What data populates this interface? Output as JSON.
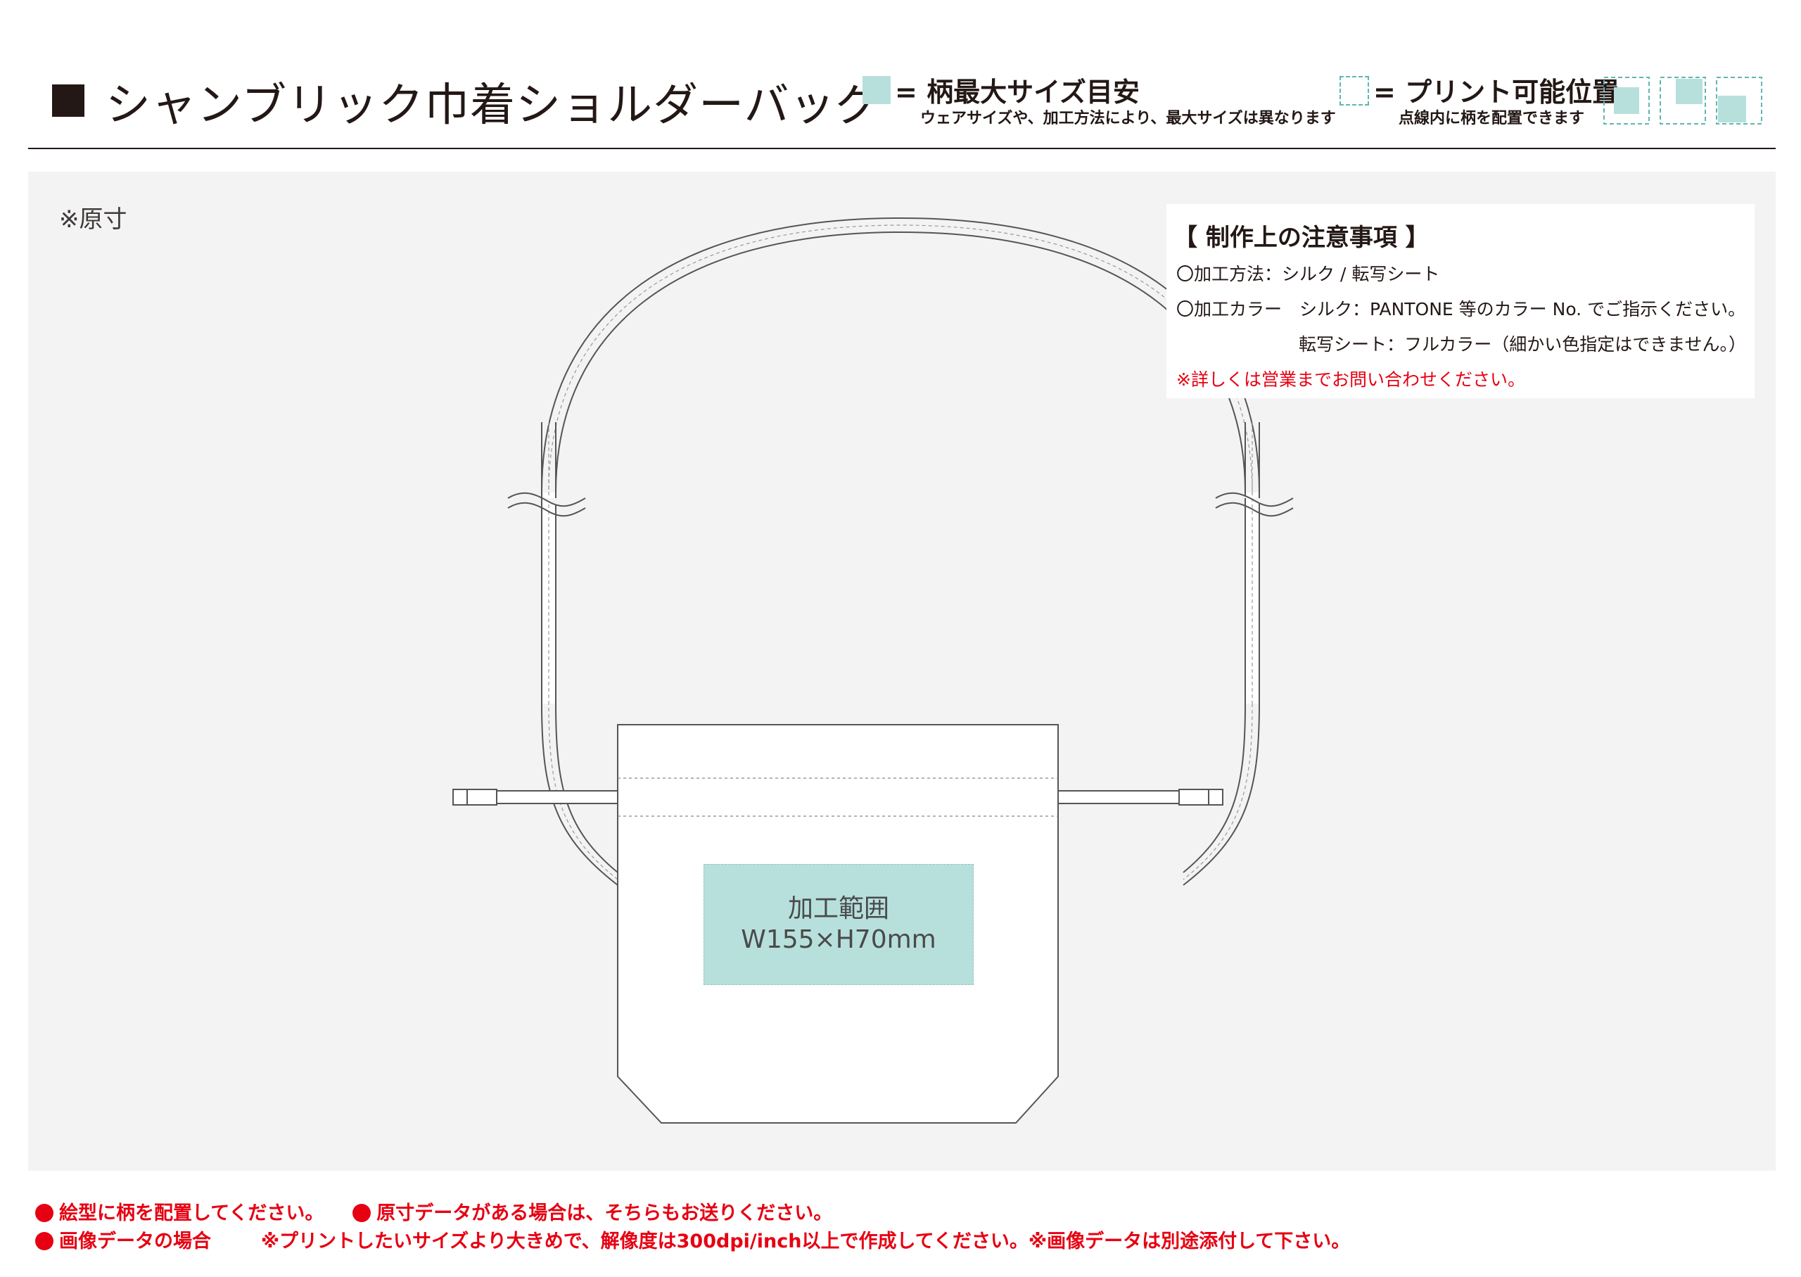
{
  "header": {
    "title": "シャンブリック巾着ショルダーバッグ",
    "legend_max_size_label": "= 柄最大サイズ目安",
    "legend_max_size_note": "ウェアサイズや、加工方法により、最大サイズは異なります",
    "legend_position_label": "= プリント可能位置",
    "legend_position_note": "点線内に柄を配置できます",
    "swatch_color": "#b7e0dd",
    "dash_color": "#5fb7b0"
  },
  "canvas": {
    "original_size_note": "※原寸"
  },
  "notes": {
    "title": "【 制作上の注意事項 】",
    "method": "〇加工方法：シルク / 転写シート",
    "color_silk": "〇加工カラー　シルク：PANTONE 等のカラー No. でご指示ください。",
    "color_transfer": "転写シート：フルカラー（細かい色指定はできません。）",
    "contact": "※詳しくは営業までお問い合わせください。",
    "contact_color": "#e60012"
  },
  "print_area": {
    "label_line1": "加工範囲",
    "label_line2": "W155×H70mm"
  },
  "footer": {
    "line1_a": "絵型に柄を配置してください。",
    "line1_b": "原寸データがある場合は、そちらもお送りください。",
    "line2_a": "画像データの場合",
    "line2_b": "※プリントしたいサイズより大きめで、解像度は300dpi/inch以上で作成してください。※画像データは別途添付して下さい。",
    "accent_color": "#e60012"
  }
}
